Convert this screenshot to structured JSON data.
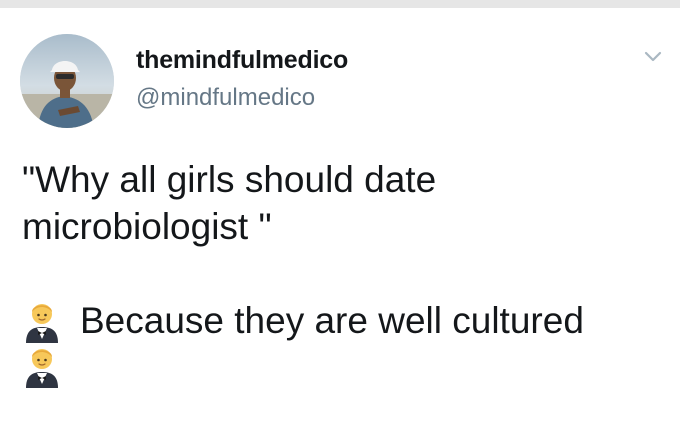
{
  "tweet": {
    "display_name": "themindfulmedico",
    "handle": "@mindfulmedico",
    "lines": [
      "\"Why all girls should date",
      "microbiologist \""
    ],
    "emoji_line_text": "Because they are well cultured"
  },
  "icons": {
    "menu": "chevron-down-icon",
    "emoji": "man-in-tuxedo-emoji"
  },
  "colors": {
    "text": "#14171a",
    "secondary_text": "#657786",
    "chevron": "#aab8c2"
  }
}
